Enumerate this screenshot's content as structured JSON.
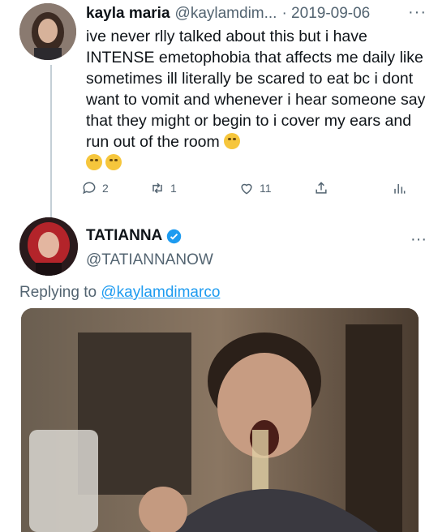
{
  "tweet": {
    "name": "kayla maria",
    "handle": "@kaylamdim...",
    "date": "· 2019-09-06",
    "more": "···",
    "text": "ive never rlly talked about this but i have INTENSE emetophobia that affects me daily like sometimes ill literally be scared to eat bc i dont want to vomit and whenever i hear someone say that they might or begin to i cover my ears and run out of the room",
    "actions": {
      "replies": "2",
      "retweets": "1",
      "likes": "11"
    }
  },
  "reply": {
    "name": "TATIANNA",
    "handle": "@TATIANNANOW",
    "more": "···",
    "replying_prefix": "Replying to",
    "replying_to": "@kaylamdimarco"
  },
  "colors": {
    "link": "#1d9bf0",
    "muted": "#536471",
    "verified": "#1d9bf0"
  }
}
